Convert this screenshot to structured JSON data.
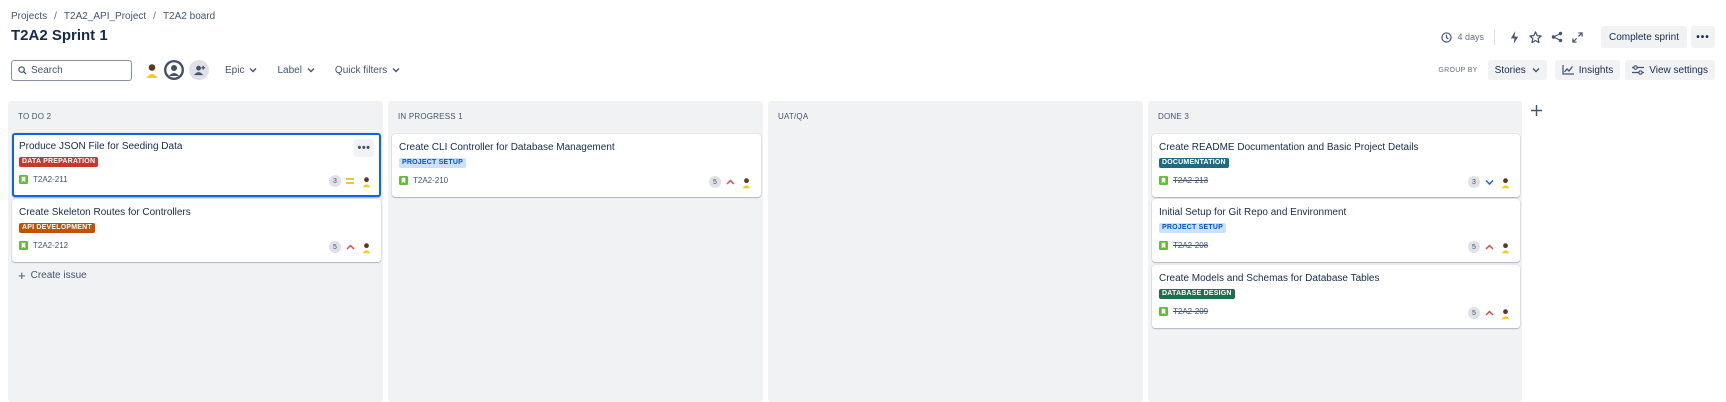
{
  "breadcrumb": [
    "Projects",
    "T2A2_API_Project",
    "T2A2 board"
  ],
  "title": "T2A2 Sprint 1",
  "header": {
    "days": "4 days",
    "complete_sprint": "Complete sprint"
  },
  "toolbar": {
    "search_placeholder": "Search",
    "filters": [
      "Epic",
      "Label",
      "Quick filters"
    ],
    "group_by_label": "GROUP BY",
    "group_by_value": "Stories",
    "insights": "Insights",
    "view_settings": "View settings"
  },
  "columns": [
    {
      "header": "TO DO 2",
      "cards": [
        {
          "title": "Produce JSON File for Seeding Data",
          "label": "DATA PREPARATION",
          "key": "T2A2-211",
          "points": "3",
          "priority": "medium"
        },
        {
          "title": "Create Skeleton Routes for Controllers",
          "label": "API DEVELOPMENT",
          "key": "T2A2-212",
          "points": "5",
          "priority": "high"
        }
      ],
      "create_issue": "Create issue"
    },
    {
      "header": "IN PROGRESS 1",
      "cards": [
        {
          "title": "Create CLI Controller for Database Management",
          "label": "PROJECT SETUP",
          "key": "T2A2-210",
          "points": "5",
          "priority": "high"
        }
      ]
    },
    {
      "header": "UAT/QA",
      "cards": []
    },
    {
      "header": "DONE 3",
      "cards": [
        {
          "title": "Create README Documentation and Basic Project Details",
          "label": "DOCUMENTATION",
          "key": "T2A2-213",
          "points": "3",
          "priority": "low"
        },
        {
          "title": "Initial Setup for Git Repo and Environment",
          "label": "PROJECT SETUP",
          "key": "T2A2-208",
          "points": "5",
          "priority": "high"
        },
        {
          "title": "Create Models and Schemas for Database Tables",
          "label": "DATABASE DESIGN",
          "key": "T2A2-209",
          "points": "5",
          "priority": "high"
        }
      ]
    }
  ],
  "colors": {
    "data_preparation": "#c9372c",
    "api_development": "#c25100",
    "project_setup_bg": "#cce0ff",
    "project_setup_fg": "#0055cc",
    "documentation": "#206a83",
    "database_design": "#216e4e",
    "story_icon": "#63ba3c",
    "priority_high": "#e2483d",
    "priority_medium": "#e2b203",
    "priority_low": "#0c66e4",
    "selected_border": "#0c66e4"
  },
  "icons": [
    "clock-icon",
    "lightning-icon",
    "star-icon",
    "share-icon",
    "expand-icon",
    "search-icon",
    "chevron-down-icon",
    "insights-chart-icon",
    "settings-sliders-icon",
    "plus-icon",
    "story-icon",
    "avatar-icon",
    "add-people-icon"
  ]
}
